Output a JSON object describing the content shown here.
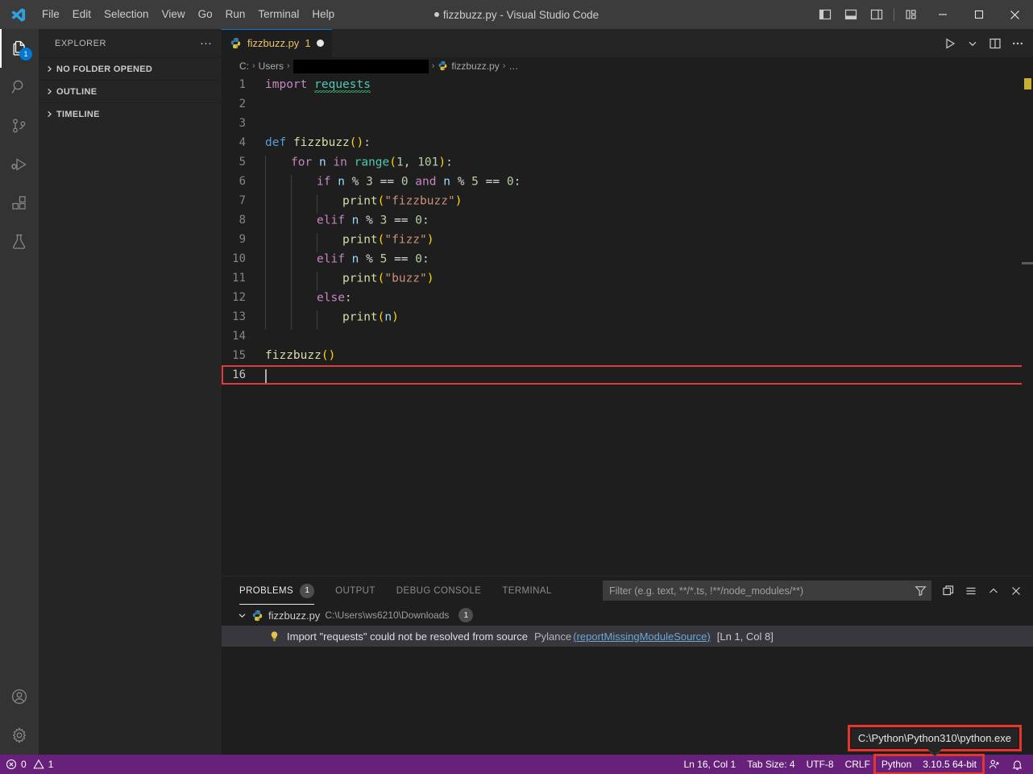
{
  "window": {
    "title": "fizzbuzz.py - Visual Studio Code",
    "dirty": true
  },
  "menubar": {
    "items": [
      "File",
      "Edit",
      "Selection",
      "View",
      "Go",
      "Run",
      "Terminal",
      "Help"
    ]
  },
  "titlebar_actions": {
    "toggle_primary_sidebar": "toggle-primary-sidebar",
    "toggle_panel": "toggle-panel",
    "toggle_secondary_sidebar": "toggle-secondary-sidebar",
    "customize_layout": "customize-layout",
    "minimize": "minimize",
    "maximize": "maximize",
    "close": "close"
  },
  "activitybar": {
    "items": [
      {
        "name": "explorer",
        "icon": "files-icon",
        "badge": "1",
        "active": true
      },
      {
        "name": "search",
        "icon": "search-icon",
        "badge": "",
        "active": false
      },
      {
        "name": "source-control",
        "icon": "source-control-icon",
        "badge": "",
        "active": false
      },
      {
        "name": "run-and-debug",
        "icon": "run-debug-icon",
        "badge": "",
        "active": false
      },
      {
        "name": "extensions",
        "icon": "extensions-icon",
        "badge": "",
        "active": false
      },
      {
        "name": "testing",
        "icon": "beaker-icon",
        "badge": "",
        "active": false
      }
    ],
    "bottom": [
      {
        "name": "accounts",
        "icon": "account-icon"
      },
      {
        "name": "manage",
        "icon": "gear-icon"
      }
    ]
  },
  "sidebar": {
    "title": "EXPLORER",
    "more_label": "···",
    "sections": [
      {
        "label": "NO FOLDER OPENED",
        "expanded": false
      },
      {
        "label": "OUTLINE",
        "expanded": false
      },
      {
        "label": "TIMELINE",
        "expanded": false
      }
    ]
  },
  "tabs": [
    {
      "label": "fizzbuzz.py",
      "count": "1",
      "dirty": true,
      "icon": "python-icon",
      "active": true
    }
  ],
  "editor_actions": {
    "run": "run-python-file",
    "run_dropdown": "run-options-chevron",
    "split": "split-editor-right",
    "more": "more-actions"
  },
  "breadcrumb": {
    "items": [
      {
        "label": "C:",
        "type": "text"
      },
      {
        "label": "Users",
        "type": "text"
      },
      {
        "label": "",
        "type": "redacted"
      },
      {
        "label": "fizzbuzz.py",
        "type": "file"
      },
      {
        "label": "…",
        "type": "text"
      }
    ],
    "separator": "›"
  },
  "code": {
    "language": "python",
    "lines": [
      {
        "n": 1,
        "text": "import requests"
      },
      {
        "n": 2,
        "text": ""
      },
      {
        "n": 3,
        "text": ""
      },
      {
        "n": 4,
        "text": "def fizzbuzz():"
      },
      {
        "n": 5,
        "text": "    for n in range(1, 101):"
      },
      {
        "n": 6,
        "text": "        if n % 3 == 0 and n % 5 == 0:"
      },
      {
        "n": 7,
        "text": "            print(\"fizzbuzz\")"
      },
      {
        "n": 8,
        "text": "        elif n % 3 == 0:"
      },
      {
        "n": 9,
        "text": "            print(\"fizz\")"
      },
      {
        "n": 10,
        "text": "        elif n % 5 == 0:"
      },
      {
        "n": 11,
        "text": "            print(\"buzz\")"
      },
      {
        "n": 12,
        "text": "        else:"
      },
      {
        "n": 13,
        "text": "            print(n)"
      },
      {
        "n": 14,
        "text": ""
      },
      {
        "n": 15,
        "text": "fizzbuzz()"
      },
      {
        "n": 16,
        "text": ""
      }
    ],
    "cursor_line": 16,
    "highlighted_line": 16
  },
  "panel": {
    "tabs": [
      {
        "label": "PROBLEMS",
        "badge": "1",
        "active": true
      },
      {
        "label": "OUTPUT",
        "badge": "",
        "active": false
      },
      {
        "label": "DEBUG CONSOLE",
        "badge": "",
        "active": false
      },
      {
        "label": "TERMINAL",
        "badge": "",
        "active": false
      }
    ],
    "filter": {
      "value": "",
      "placeholder": "Filter (e.g. text, **/*.ts, !**/node_modules/**)"
    },
    "actions": {
      "filter": "filter-icon",
      "view_as_table": "view-as-table-icon",
      "more": "panel-more-icon",
      "maximize": "maximize-panel-icon",
      "close": "close-panel-icon"
    },
    "problems": {
      "file": {
        "name": "fizzbuzz.py",
        "path": "C:\\Users\\ws6210\\Downloads",
        "count": "1",
        "expanded": true
      },
      "items": [
        {
          "severity": "warning",
          "icon": "lightbulb-icon",
          "message": "Import \"requests\" could not be resolved from source",
          "source": "Pylance",
          "code": "(reportMissingModuleSource)",
          "position": "[Ln 1, Col 8]"
        }
      ]
    }
  },
  "statusbar": {
    "background": "#68217a",
    "left": [
      {
        "name": "problems",
        "icon": "error-icon",
        "errors": "0",
        "warn_icon": "warning-icon",
        "warnings": "1"
      }
    ],
    "right": [
      {
        "name": "editor-position",
        "label": "Ln 16, Col 1"
      },
      {
        "name": "tab-size",
        "label": "Tab Size: 4"
      },
      {
        "name": "encoding",
        "label": "UTF-8"
      },
      {
        "name": "eol",
        "label": "CRLF"
      },
      {
        "name": "language-mode",
        "label": "Python",
        "highlighted": true
      },
      {
        "name": "python-interpreter",
        "label": "3.10.5 64-bit",
        "highlighted": true
      },
      {
        "name": "remote-indicator",
        "icon": "remote-icon"
      },
      {
        "name": "notifications",
        "icon": "bell-icon"
      }
    ]
  },
  "tooltip": {
    "text": "C:\\Python\\Python310\\python.exe",
    "border_color": "#e8352b"
  },
  "colors": {
    "accent": "#0078d4",
    "statusbar": "#68217a",
    "annotation_red": "#e8352b",
    "editor_bg": "#1e1e1e",
    "sidebar_bg": "#252526",
    "activitybar_bg": "#333333",
    "titlebar_bg": "#3c3c3c"
  }
}
